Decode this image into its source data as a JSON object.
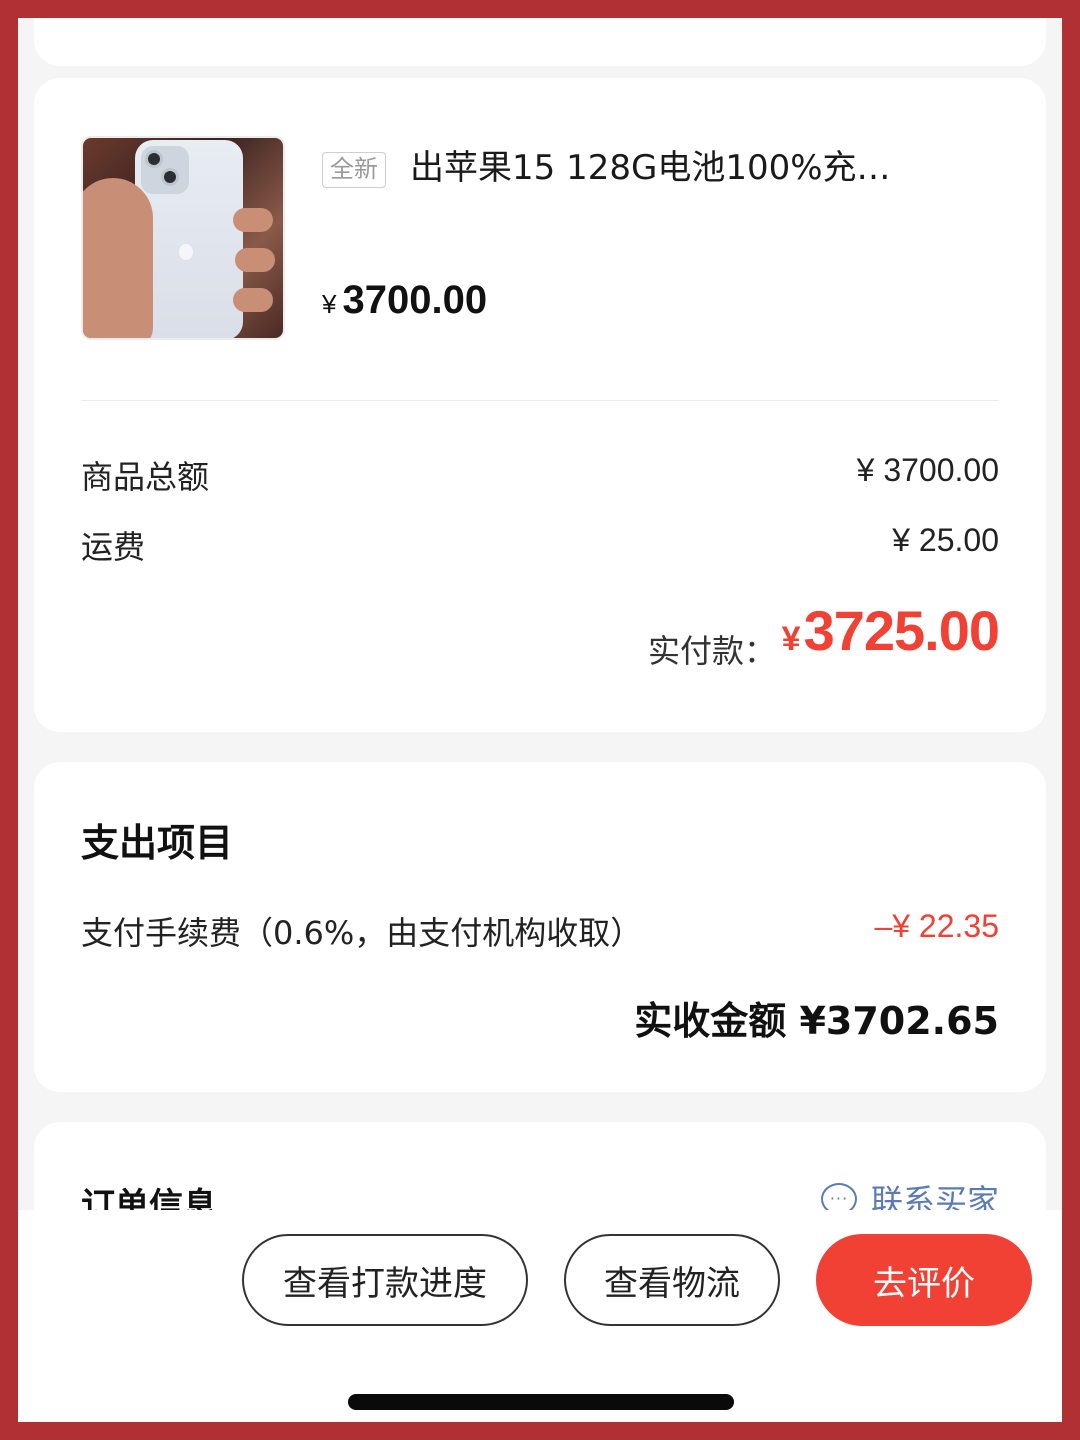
{
  "product": {
    "tag": "全新",
    "title": "出苹果15 128G电池100%充…",
    "price_currency": "¥",
    "price": "3700.00"
  },
  "summary": {
    "subtotal_label": "商品总额",
    "subtotal_value": "¥ 3700.00",
    "shipping_label": "运费",
    "shipping_value": "¥ 25.00",
    "paid_label": "实付款：",
    "paid_currency": "¥",
    "paid_value": "3725.00"
  },
  "expense": {
    "title": "支出项目",
    "fee_label": "支付手续费（0.6%，由支付机构收取）",
    "fee_value": "–¥ 22.35",
    "net_value": "实收金额 ¥3702.65"
  },
  "order_info": {
    "title": "订单信息",
    "contact_label": "联系买家",
    "contact_icon": "chat-bubble-icon"
  },
  "actions": {
    "progress_label": "查看打款进度",
    "logistics_label": "查看物流",
    "review_label": "去评价"
  },
  "colors": {
    "accent": "#f04134",
    "link": "#5a7bb5",
    "frame": "#b13034"
  }
}
